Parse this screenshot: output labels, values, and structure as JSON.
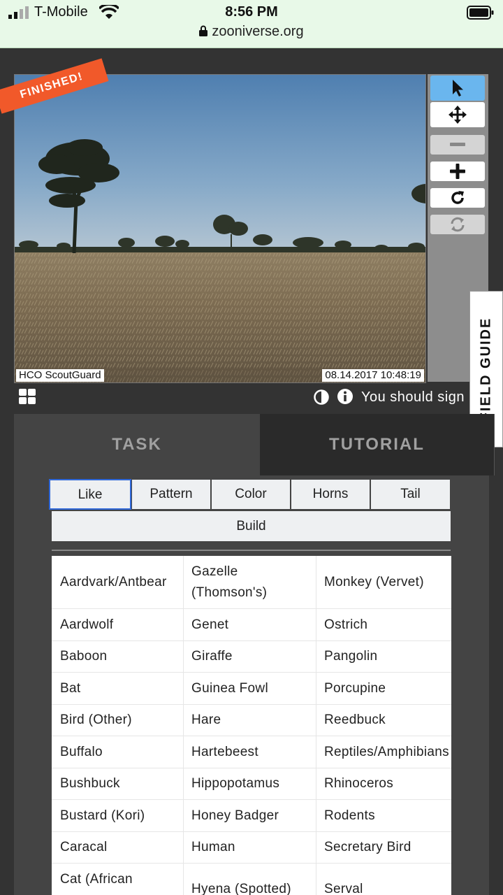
{
  "status_bar": {
    "carrier": "T-Mobile",
    "time": "8:56 PM",
    "url": "zooniverse.org"
  },
  "viewer": {
    "finished_label": "FINISHED!",
    "camera_brand": "HCO ScoutGuard",
    "timestamp": "08.14.2017  10:48:19"
  },
  "toolbar": {
    "tools": [
      "pointer-icon",
      "move-icon",
      "zoom-out-icon",
      "zoom-in-icon",
      "rotate-icon",
      "reset-icon"
    ],
    "active_color": "#6ab6ee"
  },
  "field_guide_label": "FIELD GUIDE",
  "meta": {
    "signin_text": "You should sign"
  },
  "tabs": {
    "task": "TASK",
    "tutorial": "TUTORIAL"
  },
  "filters": [
    "Like",
    "Pattern",
    "Color",
    "Horns",
    "Tail"
  ],
  "filter_build": "Build",
  "species": {
    "col1": [
      "Aardvark/Antbear",
      "Aardwolf",
      "Baboon",
      "Bat",
      "Bird (Other)",
      "Buffalo",
      "Bushbuck",
      "Bustard (Kori)",
      "Caracal",
      "Cat (African"
    ],
    "col2": [
      "Gazelle (Thomson's)",
      "Genet",
      "Giraffe",
      "Guinea Fowl",
      "Hare",
      "Hartebeest",
      "Hippopotamus",
      "Honey Badger",
      "Human",
      "Hyena (Spotted)"
    ],
    "col3": [
      "Monkey (Vervet)",
      "Ostrich",
      "Pangolin",
      "Porcupine",
      "Reedbuck",
      "Reptiles/Amphibians",
      "Rhinoceros",
      "Rodents",
      "Secretary Bird",
      "Serval"
    ]
  },
  "colors": {
    "status_bar_bg": "#e8f9e8",
    "finished_banner": "#f1592a",
    "panel_bg": "#444444",
    "active_filter_border": "#2f67d8"
  }
}
